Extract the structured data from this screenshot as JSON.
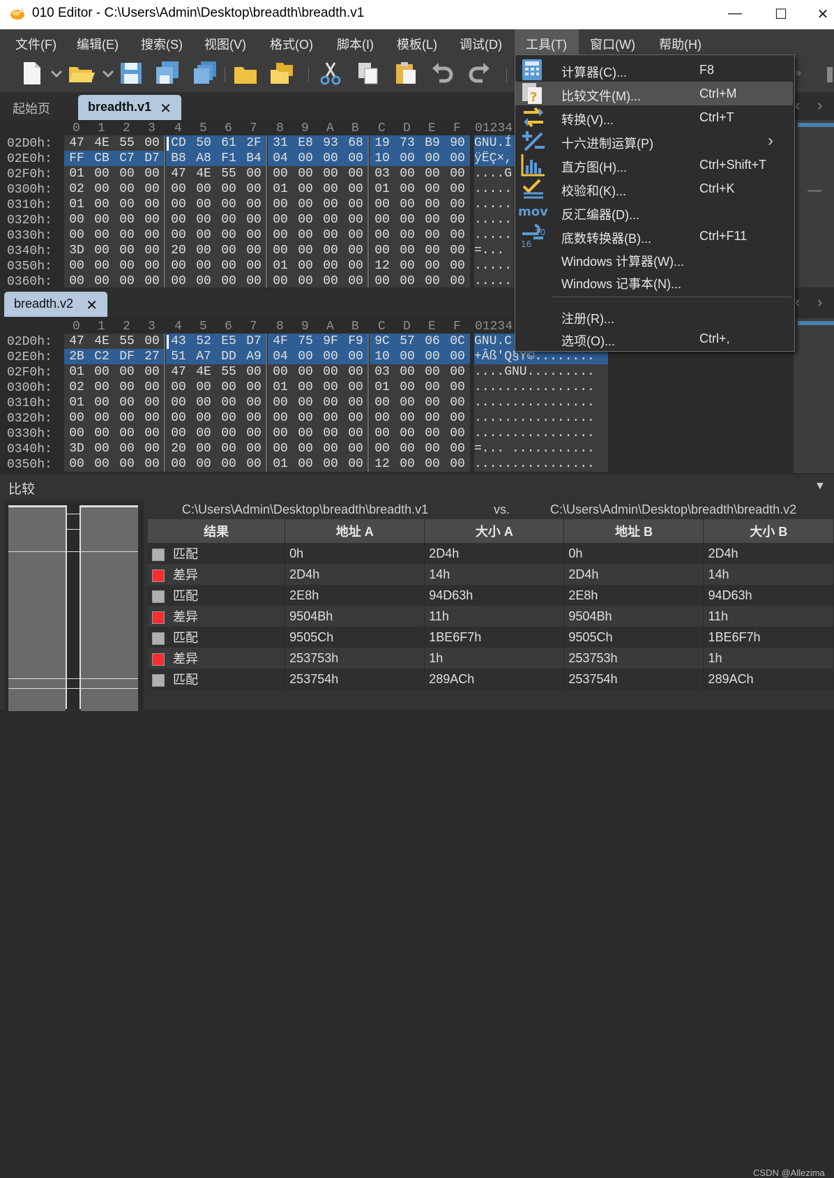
{
  "window": {
    "title": "010 Editor - C:\\Users\\Admin\\Desktop\\breadth\\breadth.v1"
  },
  "menubar": {
    "items": [
      "文件(F)",
      "编辑(E)",
      "搜索(S)",
      "视图(V)",
      "格式(O)",
      "脚本(I)",
      "模板(L)",
      "调试(D)",
      "工具(T)",
      "窗口(W)",
      "帮助(H)"
    ]
  },
  "tabs": {
    "start": "起始页",
    "file1": "breadth.v1",
    "file2": "breadth.v2",
    "close": "✕"
  },
  "hex": {
    "columns": [
      "0",
      "1",
      "2",
      "3",
      "4",
      "5",
      "6",
      "7",
      "8",
      "9",
      "A",
      "B",
      "C",
      "D",
      "E",
      "F"
    ],
    "ascii_header": "01234",
    "pane1": [
      {
        "addr": "02D0h:",
        "bytes": [
          "47",
          "4E",
          "55",
          "00",
          "CD",
          "50",
          "61",
          "2F",
          "31",
          "E8",
          "93",
          "68",
          "19",
          "73",
          "B9",
          "90"
        ],
        "ascii": "GNU.Í"
      },
      {
        "addr": "02E0h:",
        "bytes": [
          "FF",
          "CB",
          "C7",
          "D7",
          "B8",
          "A8",
          "F1",
          "B4",
          "04",
          "00",
          "00",
          "00",
          "10",
          "00",
          "00",
          "00"
        ],
        "ascii": "ÿËÇ×,"
      },
      {
        "addr": "02F0h:",
        "bytes": [
          "01",
          "00",
          "00",
          "00",
          "47",
          "4E",
          "55",
          "00",
          "00",
          "00",
          "00",
          "00",
          "03",
          "00",
          "00",
          "00"
        ],
        "ascii": "....G"
      },
      {
        "addr": "0300h:",
        "bytes": [
          "02",
          "00",
          "00",
          "00",
          "00",
          "00",
          "00",
          "00",
          "01",
          "00",
          "00",
          "00",
          "01",
          "00",
          "00",
          "00"
        ],
        "ascii": "....."
      },
      {
        "addr": "0310h:",
        "bytes": [
          "01",
          "00",
          "00",
          "00",
          "00",
          "00",
          "00",
          "00",
          "00",
          "00",
          "00",
          "00",
          "00",
          "00",
          "00",
          "00"
        ],
        "ascii": "....."
      },
      {
        "addr": "0320h:",
        "bytes": [
          "00",
          "00",
          "00",
          "00",
          "00",
          "00",
          "00",
          "00",
          "00",
          "00",
          "00",
          "00",
          "00",
          "00",
          "00",
          "00"
        ],
        "ascii": "....."
      },
      {
        "addr": "0330h:",
        "bytes": [
          "00",
          "00",
          "00",
          "00",
          "00",
          "00",
          "00",
          "00",
          "00",
          "00",
          "00",
          "00",
          "00",
          "00",
          "00",
          "00"
        ],
        "ascii": "....."
      },
      {
        "addr": "0340h:",
        "bytes": [
          "3D",
          "00",
          "00",
          "00",
          "20",
          "00",
          "00",
          "00",
          "00",
          "00",
          "00",
          "00",
          "00",
          "00",
          "00",
          "00"
        ],
        "ascii": "=... "
      },
      {
        "addr": "0350h:",
        "bytes": [
          "00",
          "00",
          "00",
          "00",
          "00",
          "00",
          "00",
          "00",
          "01",
          "00",
          "00",
          "00",
          "12",
          "00",
          "00",
          "00"
        ],
        "ascii": "....."
      },
      {
        "addr": "0360h:",
        "bytes": [
          "00",
          "00",
          "00",
          "00",
          "00",
          "00",
          "00",
          "00",
          "00",
          "00",
          "00",
          "00",
          "00",
          "00",
          "00",
          "00"
        ],
        "ascii": "....."
      }
    ],
    "pane2": [
      {
        "addr": "02D0h:",
        "bytes": [
          "47",
          "4E",
          "55",
          "00",
          "43",
          "52",
          "E5",
          "D7",
          "4F",
          "75",
          "9F",
          "F9",
          "9C",
          "57",
          "06",
          "0C"
        ],
        "ascii": "GNU.C"
      },
      {
        "addr": "02E0h:",
        "bytes": [
          "2B",
          "C2",
          "DF",
          "27",
          "51",
          "A7",
          "DD",
          "A9",
          "04",
          "00",
          "00",
          "00",
          "10",
          "00",
          "00",
          "00"
        ],
        "ascii": "+Âß'Q§Ý©........"
      },
      {
        "addr": "02F0h:",
        "bytes": [
          "01",
          "00",
          "00",
          "00",
          "47",
          "4E",
          "55",
          "00",
          "00",
          "00",
          "00",
          "00",
          "03",
          "00",
          "00",
          "00"
        ],
        "ascii": "....GNU........."
      },
      {
        "addr": "0300h:",
        "bytes": [
          "02",
          "00",
          "00",
          "00",
          "00",
          "00",
          "00",
          "00",
          "01",
          "00",
          "00",
          "00",
          "01",
          "00",
          "00",
          "00"
        ],
        "ascii": "................"
      },
      {
        "addr": "0310h:",
        "bytes": [
          "01",
          "00",
          "00",
          "00",
          "00",
          "00",
          "00",
          "00",
          "00",
          "00",
          "00",
          "00",
          "00",
          "00",
          "00",
          "00"
        ],
        "ascii": "................"
      },
      {
        "addr": "0320h:",
        "bytes": [
          "00",
          "00",
          "00",
          "00",
          "00",
          "00",
          "00",
          "00",
          "00",
          "00",
          "00",
          "00",
          "00",
          "00",
          "00",
          "00"
        ],
        "ascii": "................"
      },
      {
        "addr": "0330h:",
        "bytes": [
          "00",
          "00",
          "00",
          "00",
          "00",
          "00",
          "00",
          "00",
          "00",
          "00",
          "00",
          "00",
          "00",
          "00",
          "00",
          "00"
        ],
        "ascii": "................"
      },
      {
        "addr": "0340h:",
        "bytes": [
          "3D",
          "00",
          "00",
          "00",
          "20",
          "00",
          "00",
          "00",
          "00",
          "00",
          "00",
          "00",
          "00",
          "00",
          "00",
          "00"
        ],
        "ascii": "=... ..........."
      },
      {
        "addr": "0350h:",
        "bytes": [
          "00",
          "00",
          "00",
          "00",
          "00",
          "00",
          "00",
          "00",
          "01",
          "00",
          "00",
          "00",
          "12",
          "00",
          "00",
          "00"
        ],
        "ascii": "................"
      }
    ]
  },
  "compare": {
    "title": "比较",
    "path_a": "C:\\Users\\Admin\\Desktop\\breadth\\breadth.v1",
    "vs": "vs.",
    "path_b": "C:\\Users\\Admin\\Desktop\\breadth\\breadth.v2",
    "headers": [
      "结果",
      "地址 A",
      "大小 A",
      "地址 B",
      "大小 B"
    ],
    "rows": [
      {
        "result": "匹配",
        "status": "match",
        "addr_a": "0h",
        "size_a": "2D4h",
        "addr_b": "0h",
        "size_b": "2D4h"
      },
      {
        "result": "差异",
        "status": "diff",
        "addr_a": "2D4h",
        "size_a": "14h",
        "addr_b": "2D4h",
        "size_b": "14h"
      },
      {
        "result": "匹配",
        "status": "match",
        "addr_a": "2E8h",
        "size_a": "94D63h",
        "addr_b": "2E8h",
        "size_b": "94D63h"
      },
      {
        "result": "差异",
        "status": "diff",
        "addr_a": "9504Bh",
        "size_a": "11h",
        "addr_b": "9504Bh",
        "size_b": "11h"
      },
      {
        "result": "匹配",
        "status": "match",
        "addr_a": "9505Ch",
        "size_a": "1BE6F7h",
        "addr_b": "9505Ch",
        "size_b": "1BE6F7h"
      },
      {
        "result": "差异",
        "status": "diff",
        "addr_a": "253753h",
        "size_a": "1h",
        "addr_b": "253753h",
        "size_b": "1h"
      },
      {
        "result": "匹配",
        "status": "match",
        "addr_a": "253754h",
        "size_a": "289ACh",
        "addr_b": "253754h",
        "size_b": "289ACh"
      }
    ],
    "colors": {
      "match": "#b0b0b0",
      "diff": "#ff2d2d"
    }
  },
  "tools_menu": {
    "items": [
      {
        "label": "计算器(C)...",
        "shortcut": "F8",
        "icon": "calculator-icon"
      },
      {
        "label": "比较文件(M)...",
        "shortcut": "Ctrl+M",
        "icon": "compare-files-icon"
      },
      {
        "label": "转换(V)...",
        "shortcut": "Ctrl+T",
        "icon": "convert-icon"
      },
      {
        "label": "十六进制运算(P)",
        "shortcut": "",
        "icon": "hex-operations-icon",
        "submenu": "›"
      },
      {
        "label": "直方图(H)...",
        "shortcut": "Ctrl+Shift+T",
        "icon": "histogram-icon"
      },
      {
        "label": "校验和(K)...",
        "shortcut": "Ctrl+K",
        "icon": "checksum-icon"
      },
      {
        "label": "反汇编器(D)...",
        "shortcut": "",
        "icon": "disassembler-icon",
        "icon_text": "mov"
      },
      {
        "label": "底数转换器(B)...",
        "shortcut": "Ctrl+F11",
        "icon": "base-converter-icon",
        "icon_text": "10\n16"
      },
      {
        "label": "Windows 计算器(W)...",
        "shortcut": ""
      },
      {
        "label": "Windows 记事本(N)...",
        "shortcut": ""
      },
      {
        "label": "注册(R)...",
        "shortcut": ""
      },
      {
        "label": "选项(O)...",
        "shortcut": "Ctrl+,"
      }
    ]
  },
  "watermark": "CSDN @Allezima"
}
